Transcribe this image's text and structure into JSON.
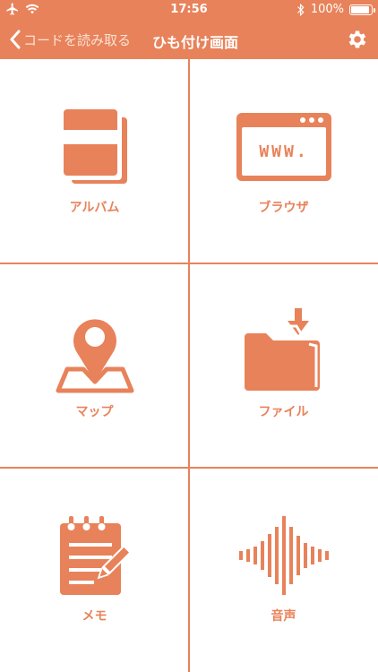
{
  "status_bar": {
    "time": "17:56",
    "battery": "100%",
    "battery_level": 1.0,
    "icons": [
      "airplane-icon",
      "wifi-icon",
      "bluetooth-icon",
      "battery-icon"
    ]
  },
  "nav": {
    "back_label": "コードを読み取る",
    "title": "ひも付け画面",
    "settings_icon": "gear-icon"
  },
  "colors": {
    "accent": "#e8825a",
    "background": "#ffffff",
    "text_on_accent": "#ffffff"
  },
  "grid": {
    "items": [
      {
        "label": "アルバム",
        "icon": "album-icon"
      },
      {
        "label": "ブラウザ",
        "icon": "browser-icon"
      },
      {
        "label": "マップ",
        "icon": "map-pin-icon"
      },
      {
        "label": "ファイル",
        "icon": "folder-download-icon"
      },
      {
        "label": "メモ",
        "icon": "notepad-icon"
      },
      {
        "label": "音声",
        "icon": "sound-wave-icon"
      }
    ],
    "browser_icon_text": "WWW."
  }
}
